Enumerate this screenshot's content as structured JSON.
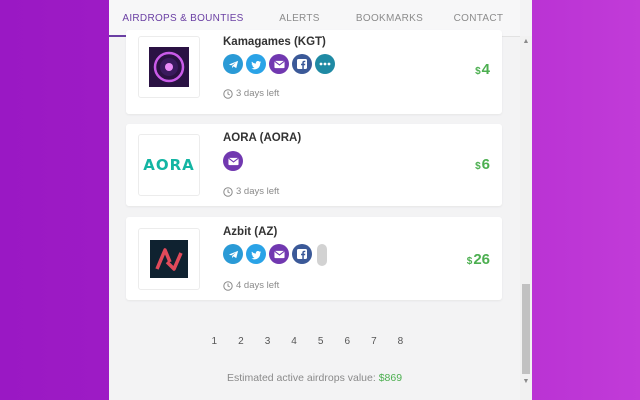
{
  "tabs": [
    {
      "label": "Airdrops & Bounties",
      "active": true
    },
    {
      "label": "Alerts"
    },
    {
      "label": "Bookmarks"
    },
    {
      "label": "Contact"
    }
  ],
  "airdrops": [
    {
      "name": "Kamagames (KGT)",
      "time_left": "3 days left",
      "currency": "$",
      "value": "4",
      "icons": [
        "telegram-icon",
        "twitter-icon",
        "email-icon",
        "facebook-icon",
        "more-icon"
      ]
    },
    {
      "name": "AORA (AORA)",
      "logo_text": "AORA",
      "time_left": "3 days left",
      "currency": "$",
      "value": "6",
      "icons": [
        "email-icon"
      ]
    },
    {
      "name": "Azbit (AZ)",
      "time_left": "4 days left",
      "currency": "$",
      "value": "26",
      "icons": [
        "telegram-icon",
        "twitter-icon",
        "email-icon",
        "facebook-icon"
      ]
    }
  ],
  "pagination": [
    "1",
    "2",
    "3",
    "4",
    "5",
    "6",
    "7",
    "8"
  ],
  "footer": {
    "label": "Estimated active airdrops value: ",
    "value": "$869"
  },
  "colors": {
    "accent": "#6a3fa3",
    "value_green": "#4caf50",
    "telegram": "#2a9ad6",
    "twitter": "#2aa3e7",
    "email": "#7138b0",
    "facebook": "#3b5998"
  }
}
